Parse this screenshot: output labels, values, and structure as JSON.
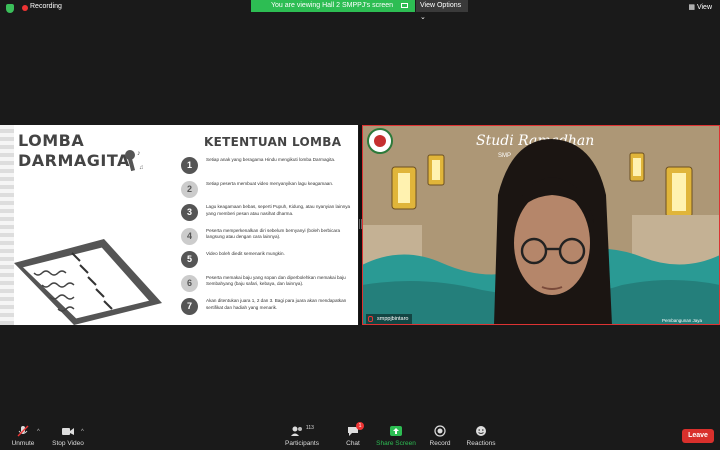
{
  "topbar": {
    "recording_label": "Recording",
    "viewing_label": "You are viewing Hall 2 SMPPJ's screen",
    "view_options_label": "View Options",
    "view_label": "View"
  },
  "slide": {
    "title_line1": "LOMBA",
    "title_line2": "DARMAGITA",
    "rules_title": "KETENTUAN LOMBA",
    "rules": [
      {
        "num": "1",
        "text": "Setiap anak yang beragama Hindu mengikuti lomba Darmagita."
      },
      {
        "num": "2",
        "text": "Setiap peserta membuat video menyanyikan lagu keagamaan."
      },
      {
        "num": "3",
        "text": "Lagu keagamaan bebas, seperti Pupuh, Kidung, atau nyanyian lainnya yang memberi pesan atau nasihat dharma."
      },
      {
        "num": "4",
        "text": "Peserta memperkenalkan diri sebelum bernyanyi (boleh berbicara langsung atau dengan cara lainnya)."
      },
      {
        "num": "5",
        "text": "Video boleh diedit semenarik mungkin."
      },
      {
        "num": "6",
        "text": "Peserta memakai baju yang sopan dan diperbolehkan memakai baju Sembahyang (baju safari, kebaya, dan lainnya)."
      },
      {
        "num": "7",
        "text": "Akan ditentukan juara 1, 2 dan 3. Bagi para juara akan mendapatkan sertifikat dan hadiah yang menarik."
      }
    ]
  },
  "video": {
    "banner_title": "Studi Ramadhan",
    "banner_sub": "SMP",
    "participant_name": "smppjbintaro",
    "footer_text": "Pembangunan Jaya"
  },
  "toolbar": {
    "unmute": "Unmute",
    "stop_video": "Stop Video",
    "participants": "Participants",
    "participants_count": "113",
    "chat": "Chat",
    "chat_badge": "1",
    "share_screen": "Share Screen",
    "record": "Record",
    "reactions": "Reactions",
    "leave": "Leave"
  },
  "colors": {
    "share_green": "#2dbd53",
    "leave_red": "#d9302c",
    "video_teal": "#2a9a94"
  }
}
